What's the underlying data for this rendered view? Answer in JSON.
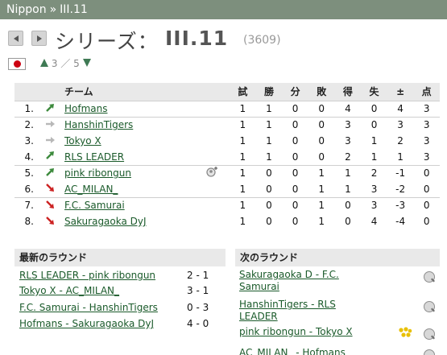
{
  "breadcrumb": {
    "root": "Nippon",
    "separator": "»",
    "current": "III.11"
  },
  "title": {
    "prefix": "シリーズ：",
    "name": "III.11",
    "id": "(3609)"
  },
  "pager": {
    "current": "3",
    "separator": "／",
    "total": "5"
  },
  "standings": {
    "headers": {
      "team": "チーム",
      "played": "試",
      "won": "勝",
      "drawn": "分",
      "lost": "敗",
      "goals_for": "得",
      "goals_against": "失",
      "diff": "±",
      "points": "点"
    },
    "rows": [
      {
        "pos": "1.",
        "trend": "up",
        "team": "Hofmans",
        "played": "1",
        "won": "1",
        "drawn": "0",
        "lost": "0",
        "gf": "4",
        "ga": "0",
        "diff": "4",
        "pts": "3"
      },
      {
        "pos": "2.",
        "trend": "same",
        "team": "HanshinTigers",
        "played": "1",
        "won": "1",
        "drawn": "0",
        "lost": "0",
        "gf": "3",
        "ga": "0",
        "diff": "3",
        "pts": "3"
      },
      {
        "pos": "3.",
        "trend": "same",
        "team": "Tokyo X",
        "played": "1",
        "won": "1",
        "drawn": "0",
        "lost": "0",
        "gf": "3",
        "ga": "1",
        "diff": "2",
        "pts": "3"
      },
      {
        "pos": "4.",
        "trend": "up",
        "team": "RLS LEADER",
        "played": "1",
        "won": "1",
        "drawn": "0",
        "lost": "0",
        "gf": "2",
        "ga": "1",
        "diff": "1",
        "pts": "3"
      },
      {
        "pos": "5.",
        "trend": "up",
        "team": "pink ribongun",
        "played": "1",
        "won": "0",
        "drawn": "0",
        "lost": "1",
        "gf": "1",
        "ga": "2",
        "diff": "-1",
        "pts": "0"
      },
      {
        "pos": "6.",
        "trend": "down",
        "team": "AC_MILAN_",
        "played": "1",
        "won": "0",
        "drawn": "0",
        "lost": "1",
        "gf": "1",
        "ga": "3",
        "diff": "-2",
        "pts": "0"
      },
      {
        "pos": "7.",
        "trend": "down",
        "team": "F.C. Samurai",
        "played": "1",
        "won": "0",
        "drawn": "0",
        "lost": "1",
        "gf": "0",
        "ga": "3",
        "diff": "-3",
        "pts": "0"
      },
      {
        "pos": "8.",
        "trend": "down",
        "team": "Sakuragaoka DyJ",
        "played": "1",
        "won": "0",
        "drawn": "0",
        "lost": "1",
        "gf": "0",
        "ga": "4",
        "diff": "-4",
        "pts": "0"
      }
    ]
  },
  "latest_round": {
    "title": "最新のラウンド",
    "matches": [
      {
        "match": "RLS LEADER - pink ribongun",
        "score": "2 - 1"
      },
      {
        "match": "Tokyo X - AC_MILAN_",
        "score": "3 - 1"
      },
      {
        "match": "F.C. Samurai - HanshinTigers",
        "score": "0 - 3"
      },
      {
        "match": "Hofmans - Sakuragaoka DyJ",
        "score": "4 - 0"
      }
    ]
  },
  "next_round": {
    "title": "次のラウンド",
    "matches": [
      {
        "match": "Sakuragaoka D - F.C. Samurai"
      },
      {
        "match": "HanshinTigers - RLS LEADER"
      },
      {
        "match": "pink ribongun - Tokyo X"
      },
      {
        "match": "AC_MILAN_ - Hofmans"
      }
    ]
  },
  "colors": {
    "header_bar": "#7d8f7d",
    "link": "#1a5a2a",
    "trend_up": "#3d8a3d",
    "trend_down": "#cc2222",
    "trend_same": "#b8b8b8"
  }
}
